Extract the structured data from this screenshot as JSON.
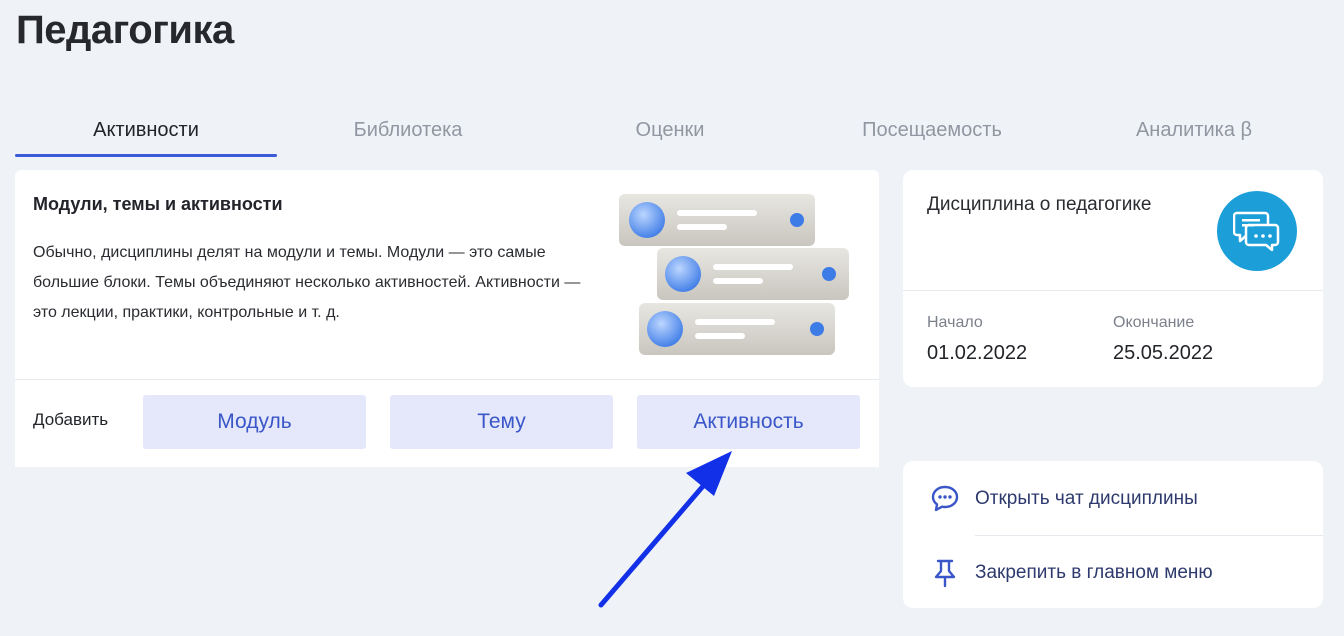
{
  "page": {
    "title": "Педагогика"
  },
  "tabs": [
    {
      "label": "Активности",
      "active": true
    },
    {
      "label": "Библиотека",
      "active": false
    },
    {
      "label": "Оценки",
      "active": false
    },
    {
      "label": "Посещаемость",
      "active": false
    },
    {
      "label": "Аналитика β",
      "active": false
    }
  ],
  "main_card": {
    "title": "Модули, темы и активности",
    "description": "Обычно, дисциплины делят на модули и темы. Модули — это самые большие блоки. Темы объединяют несколько активностей. Активности — это лекции, практики, контрольные и т. д.",
    "add_label": "Добавить",
    "buttons": {
      "module": "Модуль",
      "topic": "Тему",
      "activity": "Активность"
    }
  },
  "info_card": {
    "title": "Дисциплина о педагогике",
    "avatar_icon": "chat-bubbles-icon",
    "start_label": "Начало",
    "start_value": "01.02.2022",
    "end_label": "Окончание",
    "end_value": "25.05.2022"
  },
  "actions": {
    "open_chat": "Открыть чат дисциплины",
    "pin_menu": "Закрепить в главном меню"
  },
  "colors": {
    "accent": "#3b5bd9",
    "button_bg": "#e4e8fa",
    "button_text": "#3a56c8",
    "avatar_bg": "#1c9fd9",
    "arrow": "#1230e8"
  }
}
